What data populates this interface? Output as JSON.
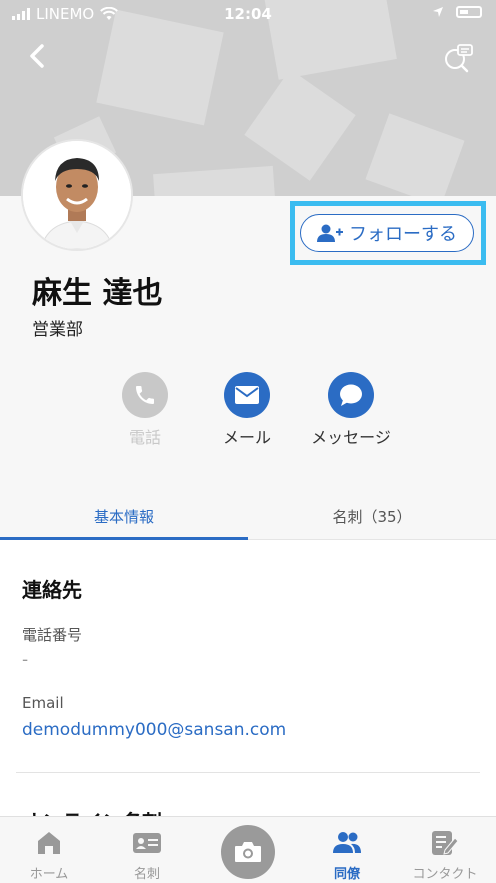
{
  "status_bar": {
    "carrier": "LINEMO",
    "time": "12:04"
  },
  "profile": {
    "name": "麻生 達也",
    "department": "営業部",
    "follow_label": "フォローする"
  },
  "actions": [
    {
      "label": "電話",
      "enabled": false
    },
    {
      "label": "メール",
      "enabled": true
    },
    {
      "label": "メッセージ",
      "enabled": true
    }
  ],
  "tabs": [
    {
      "label": "基本情報",
      "active": true
    },
    {
      "label": "名刺（35）",
      "active": false
    }
  ],
  "contact": {
    "section_title": "連絡先",
    "phone_label": "電話番号",
    "phone_value": "-",
    "email_label": "Email",
    "email_value": "demodummy000@sansan.com",
    "next_section_title": "オンライン名刺"
  },
  "bottom_nav": [
    {
      "label": "ホーム",
      "icon": "home-icon"
    },
    {
      "label": "名刺",
      "icon": "business-card-icon"
    },
    {
      "label": "",
      "icon": "camera-icon"
    },
    {
      "label": "同僚",
      "icon": "colleagues-icon",
      "active": true
    },
    {
      "label": "コンタクト",
      "icon": "contact-icon"
    }
  ],
  "colors": {
    "accent": "#2b6cc4",
    "highlight": "#3bbcf0",
    "disabled": "#c8c8c8"
  }
}
